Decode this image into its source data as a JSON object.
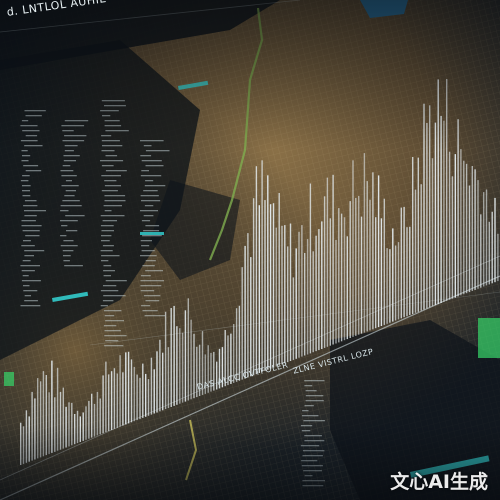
{
  "header": {
    "title": "d. LNTLOL  AUHIE"
  },
  "panel": {
    "label_left": "DAS ALCC  OVTFOLER",
    "label_right": "ZLNE  VISTRL  LOZP"
  },
  "watermark": {
    "text": "文心AI生成"
  },
  "colors": {
    "background": "#0b1116",
    "map_tan": "#7a6442",
    "map_dark": "#1a2329",
    "bars": "#e6eef2",
    "accent_cyan": "#34d6d6",
    "accent_green": "#38d66a"
  },
  "icons": {
    "accent_blocks": "cyan-highlight-icon"
  }
}
